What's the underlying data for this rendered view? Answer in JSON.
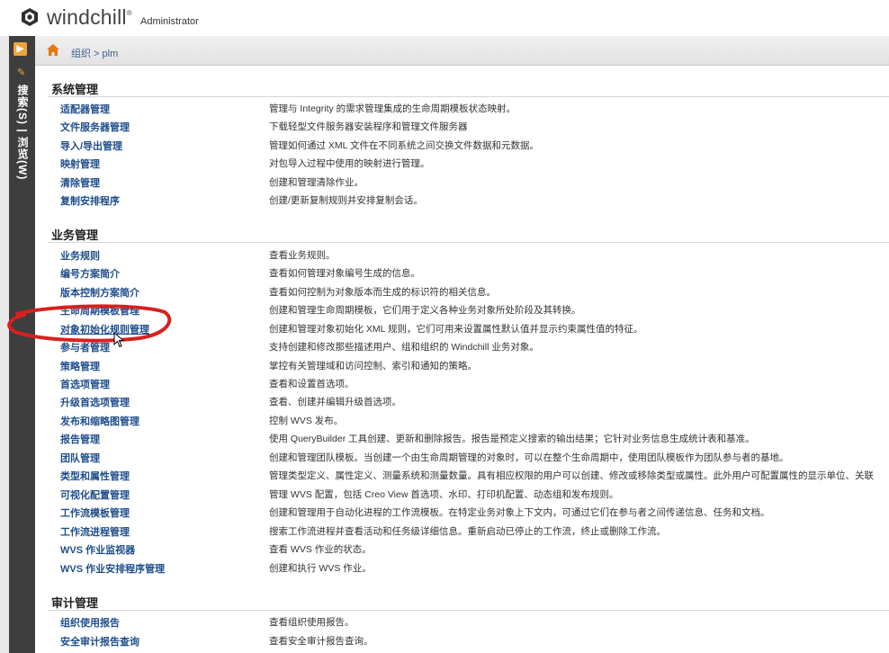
{
  "header": {
    "brand": "windchill",
    "trademark": "®",
    "user_role": "Administrator"
  },
  "sidebar": {
    "top_button_glyph": "▶",
    "vertical_label": "搜索(S) | 浏览(W)"
  },
  "breadcrumb": {
    "text": "组织 > plm"
  },
  "sections": [
    {
      "title": "系统管理",
      "items": [
        {
          "label": "适配器管理",
          "desc": "管理与 Integrity 的需求管理集成的生命周期模板状态映射。"
        },
        {
          "label": "文件服务器管理",
          "desc": "下载轻型文件服务器安装程序和管理文件服务器"
        },
        {
          "label": "导入/导出管理",
          "desc": "管理如何通过 XML 文件在不同系统之间交换文件数据和元数据。"
        },
        {
          "label": "映射管理",
          "desc": "对包导入过程中使用的映射进行管理。"
        },
        {
          "label": "清除管理",
          "desc": "创建和管理清除作业。"
        },
        {
          "label": "复制安排程序",
          "desc": "创建/更新复制规则并安排复制会话。"
        }
      ]
    },
    {
      "title": "业务管理",
      "items": [
        {
          "label": "业务规则",
          "desc": "查看业务规则。"
        },
        {
          "label": "编号方案简介",
          "desc": "查看如何管理对象编号生成的信息。"
        },
        {
          "label": "版本控制方案简介",
          "desc": "查看如何控制为对象版本而生成的标识符的相关信息。"
        },
        {
          "label": "生命周期模板管理",
          "desc": "创建和管理生命周期模板，它们用于定义各种业务对象所处阶段及其转换。"
        },
        {
          "label": "对象初始化规则管理",
          "desc": "创建和管理对象初始化 XML 规则，它们可用来设置属性默认值并显示约束属性值的特征。"
        },
        {
          "label": "参与者管理",
          "desc": "支持创建和修改那些描述用户、组和组织的 Windchill 业务对象。"
        },
        {
          "label": "策略管理",
          "desc": "掌控有关管理域和访问控制、索引和通知的策略。"
        },
        {
          "label": "首选项管理",
          "desc": "查看和设置首选项。"
        },
        {
          "label": "升级首选项管理",
          "desc": "查看、创建并编辑升级首选项。"
        },
        {
          "label": "发布和缩略图管理",
          "desc": "控制 WVS 发布。"
        },
        {
          "label": "报告管理",
          "desc": "使用 QueryBuilder 工具创建、更新和删除报告。报告是预定义搜索的输出结果；它针对业务信息生成统计表和基准。"
        },
        {
          "label": "团队管理",
          "desc": "创建和管理团队模板。当创建一个由生命周期管理的对象时，可以在整个生命周期中，使用团队模板作为团队参与者的基地。"
        },
        {
          "label": "类型和属性管理",
          "desc": "管理类型定义、属性定义、测量系统和测量数量。具有相应权限的用户可以创建、修改或移除类型或属性。此外用户可配置属性的显示单位、关联"
        },
        {
          "label": "可视化配置管理",
          "desc": "管理 WVS 配置，包括 Creo View 首选项、水印、打印机配置、动态组和发布规则。"
        },
        {
          "label": "工作流模板管理",
          "desc": "创建和管理用于自动化进程的工作流模板。在特定业务对象上下文内，可通过它们在参与者之间传递信息、任务和文档。"
        },
        {
          "label": "工作流进程管理",
          "desc": "搜索工作流进程并查看活动和任务级详细信息。重新启动已停止的工作流，终止或删除工作流。"
        },
        {
          "label": "WVS 作业监视器",
          "desc": "查看 WVS 作业的状态。"
        },
        {
          "label": "WVS 作业安排程序管理",
          "desc": "创建和执行 WVS 作业。"
        }
      ]
    },
    {
      "title": "审计管理",
      "items": [
        {
          "label": "组织使用报告",
          "desc": "查看组织使用报告。"
        },
        {
          "label": "安全审计报告查询",
          "desc": "查看安全审计报告查询。"
        }
      ]
    }
  ],
  "colors": {
    "link": "#1f4e8c",
    "annotation": "#d8201f",
    "sidebar_bg": "#3e3e3e",
    "sidebar_accent": "#f2a43b"
  },
  "icons": {
    "logo": "windchill-logo-icon",
    "home": "home-icon",
    "pin": "pin-icon",
    "cursor": "mouse-cursor-icon"
  }
}
